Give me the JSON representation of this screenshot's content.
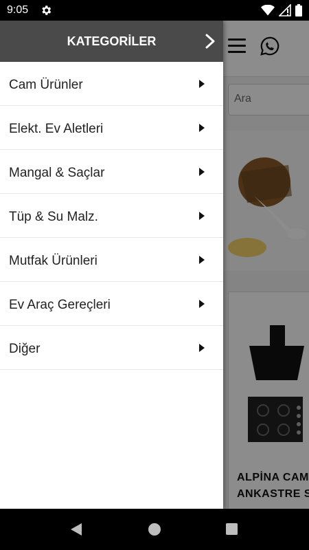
{
  "status_bar": {
    "time": "9:05",
    "icons": [
      "settings-gear-icon",
      "wifi-icon",
      "signal-icon",
      "battery-icon"
    ]
  },
  "background_app": {
    "search_placeholder": "Ara",
    "product_title": "ALPİNA CAM ANKASTRE S"
  },
  "drawer": {
    "title": "KATEGORİLER",
    "categories": [
      {
        "label": "Cam Ürünler"
      },
      {
        "label": "Elekt. Ev Aletleri"
      },
      {
        "label": "Mangal & Saçlar"
      },
      {
        "label": "Tüp & Su Malz."
      },
      {
        "label": "Mutfak Ürünleri"
      },
      {
        "label": "Ev Araç Gereçleri"
      },
      {
        "label": "Diğer"
      }
    ]
  },
  "colors": {
    "drawer_header": "#4a4a4a",
    "scrim": "rgba(0,0,0,0.45)"
  }
}
